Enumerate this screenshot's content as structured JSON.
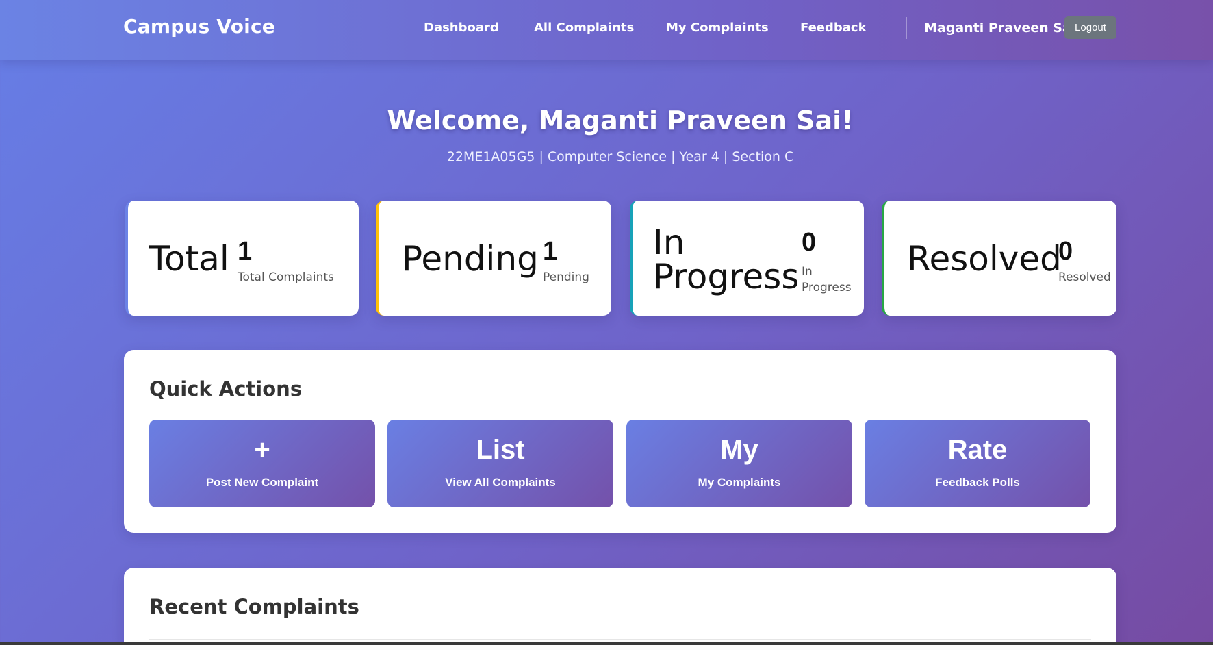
{
  "nav": {
    "brand": "Campus Voice",
    "links": [
      "Dashboard",
      "All Complaints",
      "My Complaints",
      "Feedback"
    ],
    "user": "Maganti Praveen Sai",
    "logout": "Logout"
  },
  "welcome": {
    "title": "Welcome, Maganti Praveen Sai!",
    "subtitle": "22ME1A05G5 | Computer Science | Year 4 | Section C"
  },
  "stats": [
    {
      "big": "Total",
      "value": "1",
      "label": "Total Complaints",
      "accent": "#6c83e6"
    },
    {
      "big": "Pending",
      "value": "1",
      "label": "Pending",
      "accent": "#ffc107"
    },
    {
      "big_line1": "In",
      "big_line2": "Progress",
      "value": "0",
      "label_line1": "In",
      "label_line2": "Progress",
      "accent": "#17a2b8"
    },
    {
      "big": "Resolved",
      "value": "0",
      "label": "Resolved",
      "accent": "#28a745"
    }
  ],
  "quick_actions": {
    "title": "Quick Actions",
    "buttons": [
      {
        "icon": "+",
        "label": "Post New Complaint"
      },
      {
        "icon": "List",
        "label": "View All Complaints"
      },
      {
        "icon": "My",
        "label": "My Complaints"
      },
      {
        "icon": "Rate",
        "label": "Feedback Polls"
      }
    ]
  },
  "recent": {
    "title": "Recent Complaints"
  }
}
